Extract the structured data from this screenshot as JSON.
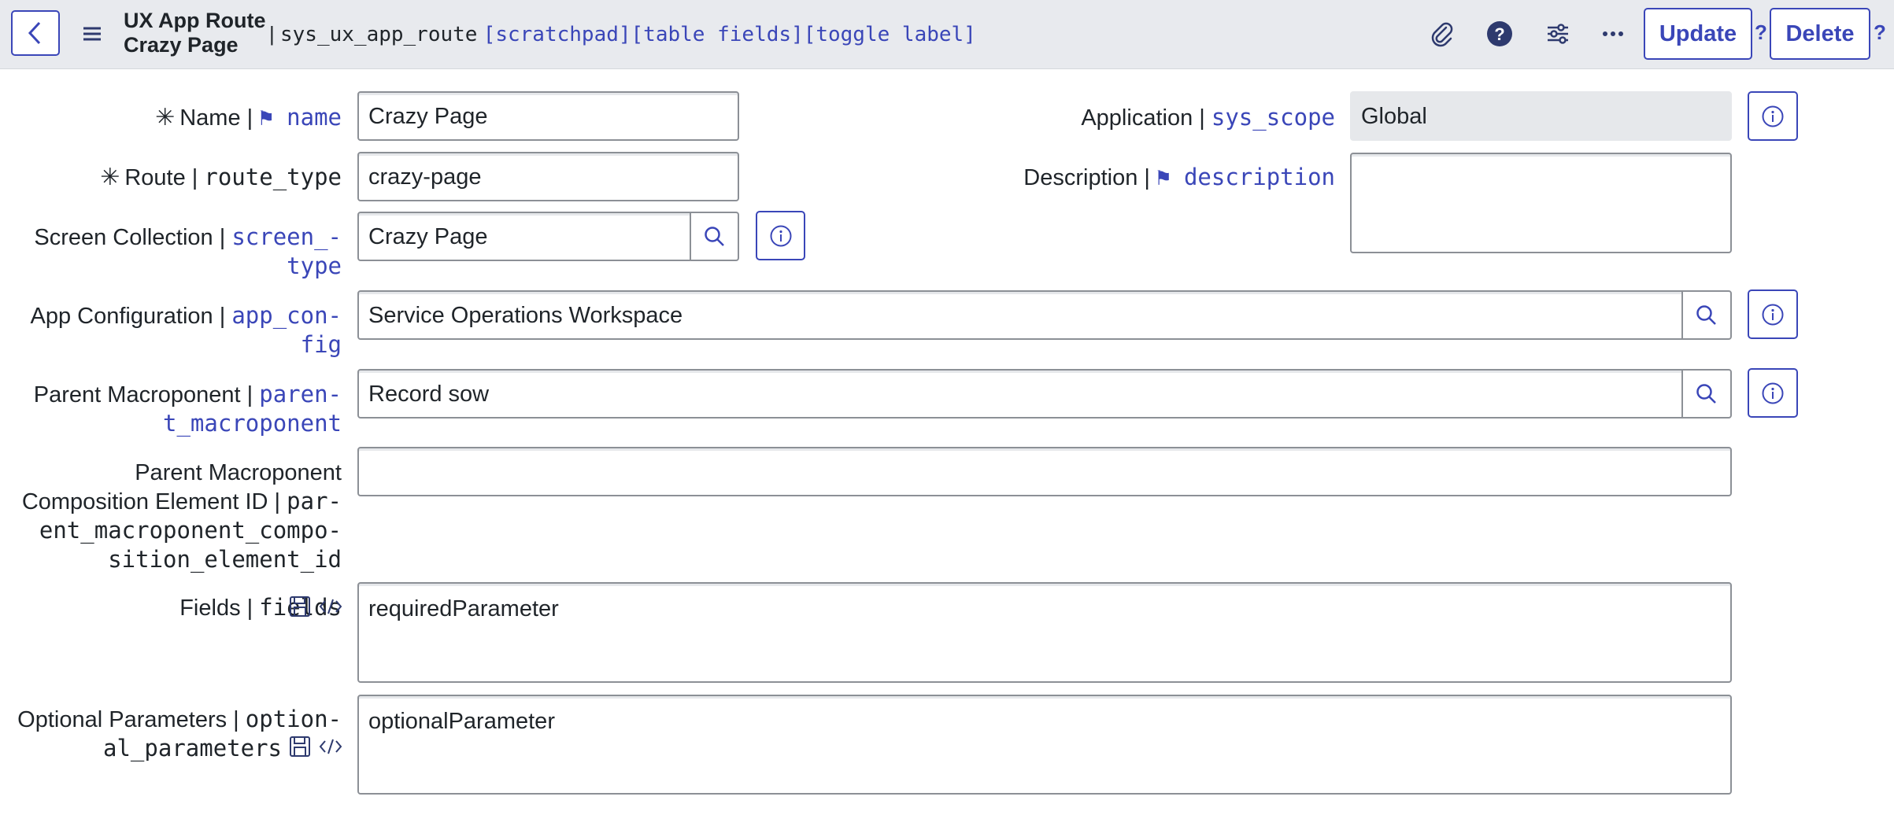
{
  "header": {
    "title_line1": "UX App Route",
    "title_line2": "Crazy Page",
    "separator": "|",
    "table_name": "sys_ux_app_route",
    "links": [
      "[scratchpad]",
      "[table fields]",
      "[toggle label]"
    ],
    "update_label": "Update",
    "delete_label": "Delete",
    "help_mark": "?",
    "icons": [
      "back-icon",
      "menu-icon",
      "paperclip-icon",
      "help-icon",
      "sliders-icon",
      "more-icon"
    ]
  },
  "form": {
    "name": {
      "label": "Name",
      "sep": " | ",
      "field": "name",
      "value": "Crazy Page"
    },
    "route": {
      "label": "Route",
      "sep": " | ",
      "field": "route_type",
      "value": "crazy-page"
    },
    "screen_collection": {
      "label": "Screen Collection",
      "sep": " | ",
      "field_line1": "screen_-",
      "field_line2": "type",
      "value": "Crazy Page"
    },
    "app_config": {
      "label": "App Configuration",
      "sep": " | ",
      "field_line1": "app_con-",
      "field_line2": "fig",
      "value": "Service Operations Workspace"
    },
    "parent_macroponent": {
      "label": "Parent Macroponent",
      "sep": " | ",
      "field_line1": "paren-",
      "field_line2": "t_macroponent",
      "value": "Record sow"
    },
    "composition_element": {
      "label_line1": "Parent Macroponent",
      "label_line2": "Composition Element ID",
      "sep": " | ",
      "field_line1": "par-",
      "field_line2": "ent_macroponent_compo-",
      "field_line3": "sition_element_id",
      "value": ""
    },
    "fields": {
      "label": "Fields",
      "sep": " | ",
      "field": "fields",
      "value": "requiredParameter"
    },
    "optional_parameters": {
      "label": "Optional Parameters",
      "sep": " | ",
      "field_line1": "option-",
      "field_line2": "al_parameters",
      "value": "optionalParameter"
    },
    "application": {
      "label": "Application",
      "sep": " | ",
      "field": "sys_scope",
      "value": "Global"
    },
    "description": {
      "label": "Description",
      "sep": " | ",
      "field": "description",
      "value": ""
    }
  },
  "colors": {
    "accent": "#3a46b8",
    "header_bg": "#e8eaee",
    "readonly_bg": "#e6e8eb"
  }
}
